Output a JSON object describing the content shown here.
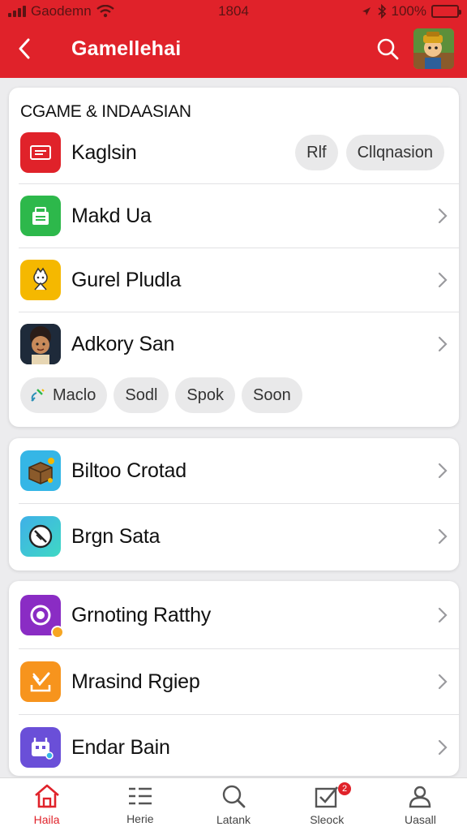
{
  "status_bar": {
    "carrier": "Gaodemn",
    "time": "1804",
    "battery": "100%",
    "battery_level": 1.0
  },
  "header": {
    "title": "Gamellehai",
    "bg_color": "#e0222a"
  },
  "section_1": {
    "title": "CGAME & INDAASIAN",
    "rows": [
      {
        "label": "Kaglsin",
        "icon": "menu-lines-icon",
        "icon_color": "#e0222a",
        "pills": [
          "Rlf",
          "Cllqnasion"
        ]
      },
      {
        "label": "Makd Ua",
        "icon": "store-icon",
        "icon_color": "#2db84b"
      },
      {
        "label": "Gurel Pludla",
        "icon": "character-icon",
        "icon_color": "#f5b800"
      },
      {
        "label": "Adkory San",
        "icon": "avatar-icon",
        "icon_color": "#2a2a2a"
      }
    ],
    "tags": [
      "Maclo",
      "Sodl",
      "Spok",
      "Soon"
    ]
  },
  "section_2": {
    "rows": [
      {
        "label": "Biltoo Crotad",
        "icon": "chest-icon",
        "icon_color": "#35b6e6"
      },
      {
        "label": "Brgn Sata",
        "icon": "compass-icon",
        "icon_color": "#3fc4d8"
      }
    ]
  },
  "section_3": {
    "rows": [
      {
        "label": "Grnoting Ratthy",
        "icon": "coin-icon",
        "icon_color": "#8a2cc4"
      },
      {
        "label": "Mrasind Rgiep",
        "icon": "check-box-icon",
        "icon_color": "#f7941d"
      },
      {
        "label": "Endar Bain",
        "icon": "robot-icon",
        "icon_color": "#6a4fd8"
      }
    ]
  },
  "tabbar": {
    "tabs": [
      {
        "label": "Haila",
        "icon": "home-icon",
        "active": true
      },
      {
        "label": "Herie",
        "icon": "list-icon",
        "active": false
      },
      {
        "label": "Latank",
        "icon": "search-icon",
        "active": false
      },
      {
        "label": "Sleock",
        "icon": "checkmark-box-icon",
        "active": false,
        "badge": "2"
      },
      {
        "label": "Uasall",
        "icon": "user-icon",
        "active": false
      }
    ]
  }
}
